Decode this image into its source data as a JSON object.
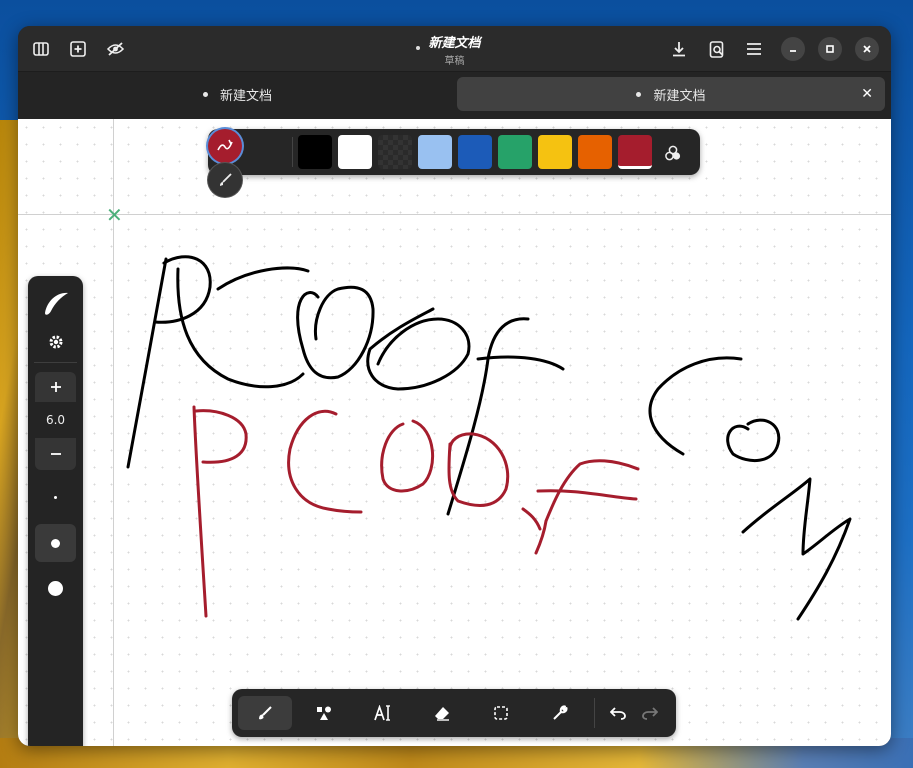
{
  "window": {
    "title": "新建文档",
    "subtitle": "草稿"
  },
  "headerbar": {
    "left_icons": [
      "sidebar-icon",
      "new-document-icon",
      "hide-icon"
    ],
    "right_icons": [
      "download-icon",
      "export-icon",
      "menu-icon"
    ],
    "window_controls": [
      "minimize-icon",
      "maximize-icon",
      "close-icon"
    ]
  },
  "tabs": [
    {
      "label": "新建文档",
      "active": false
    },
    {
      "label": "新建文档",
      "active": true
    }
  ],
  "colors": {
    "swatches": [
      "#000000",
      "#ffffff",
      "#2a2a2a",
      "#99c1f1",
      "#1c5bb8",
      "#26a269",
      "#f5c211",
      "#e66100",
      "#a51d2d"
    ],
    "stroke_black": "#000000",
    "stroke_red": "#a51d2d",
    "selected": "#a51d2d"
  },
  "left_panel": {
    "size_value": "6.0",
    "icons": [
      "pen-shape-icon",
      "settings-icon",
      "plus-icon",
      "minus-icon"
    ]
  },
  "bottom_toolbar": {
    "tools": [
      "brush-icon",
      "shapes-icon",
      "text-icon",
      "eraser-icon",
      "selection-icon",
      "wrench-icon"
    ],
    "actions": [
      "undo-icon",
      "redo-icon"
    ]
  }
}
